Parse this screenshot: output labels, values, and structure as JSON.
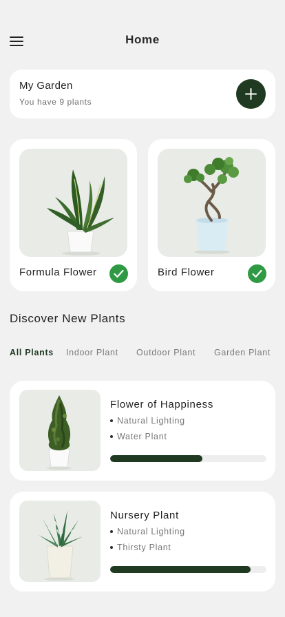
{
  "header": {
    "title": "Home",
    "menu_icon": "hamburger-menu-icon"
  },
  "garden": {
    "title": "My Garden",
    "subtitle": "You have 9 plants",
    "add_icon": "plus-icon"
  },
  "favorites": [
    {
      "name": "Formula Flower",
      "checked": true
    },
    {
      "name": "Bird Flower",
      "checked": true
    }
  ],
  "discover": {
    "title": "Discover New Plants",
    "tabs": [
      "All Plants",
      "Indoor Plant",
      "Outdoor Plant",
      "Garden Plant"
    ],
    "active_tab": "All Plants"
  },
  "plants": [
    {
      "name": "Flower of Happiness",
      "features": [
        "Natural Lighting",
        "Water Plant"
      ],
      "progress": 0.59
    },
    {
      "name": "Nursery Plant",
      "features": [
        "Natural Lighting",
        "Thirsty Plant"
      ],
      "progress": 0.9
    }
  ],
  "colors": {
    "accent": "#1f3a21",
    "check": "#2f9a43",
    "background": "#f1f1f2",
    "card": "#ffffff",
    "image_bg": "#e8ebe6"
  }
}
